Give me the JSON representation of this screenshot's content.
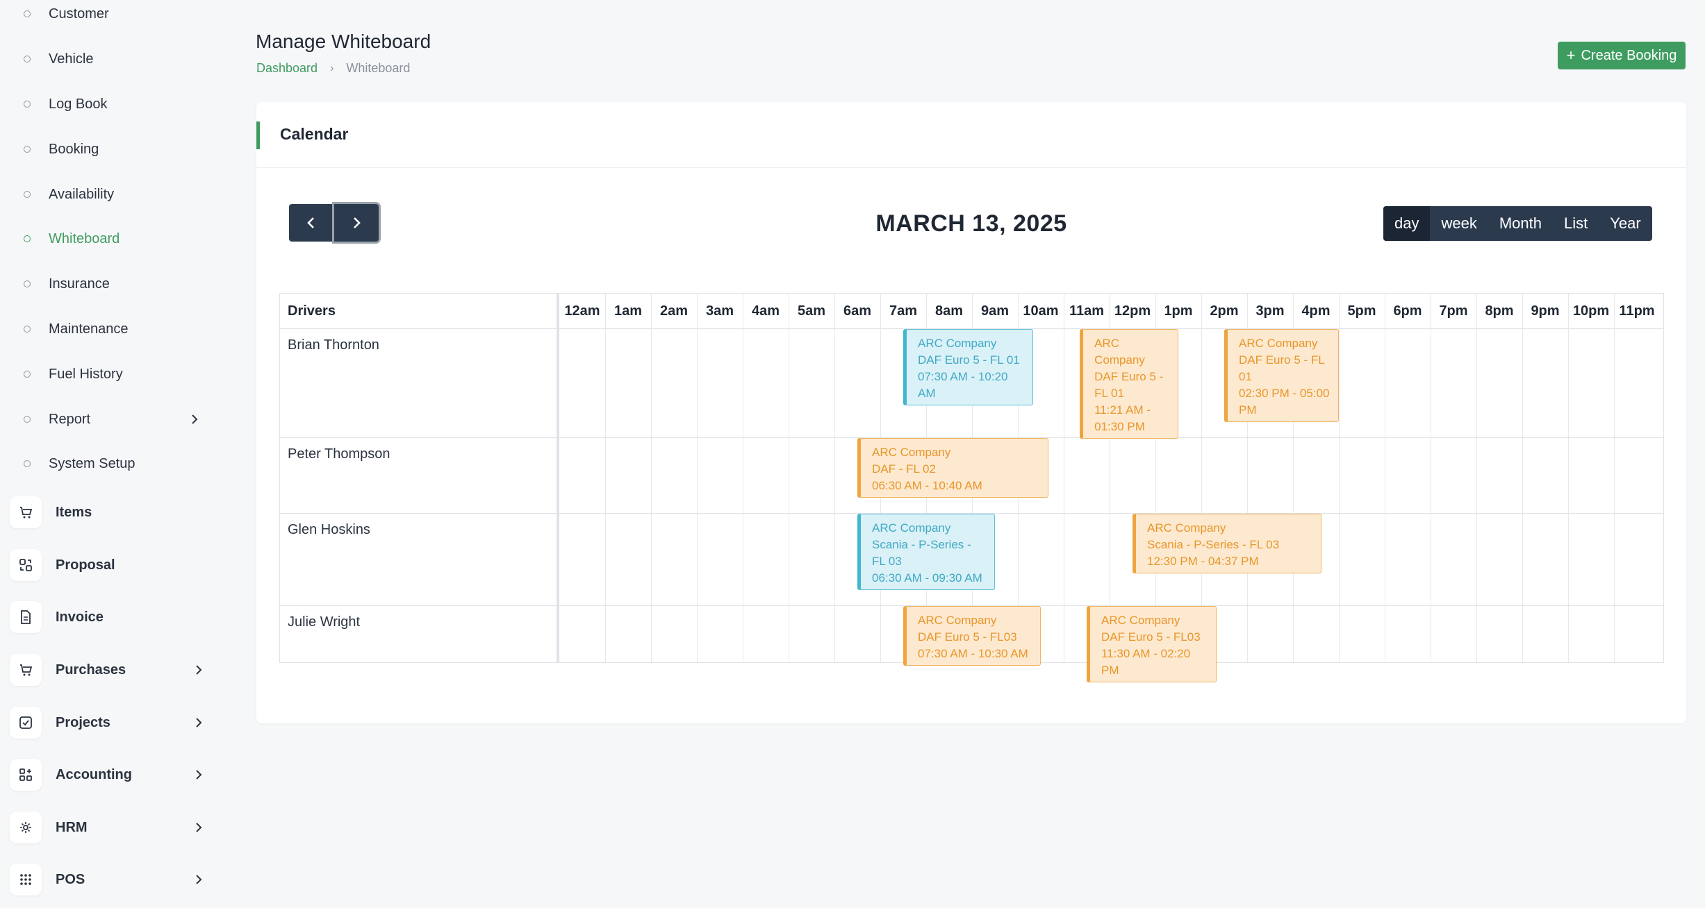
{
  "sidebar": {
    "sub_items": [
      {
        "label": "Customer"
      },
      {
        "label": "Vehicle"
      },
      {
        "label": "Log Book"
      },
      {
        "label": "Booking"
      },
      {
        "label": "Availability"
      },
      {
        "label": "Whiteboard",
        "active": true
      },
      {
        "label": "Insurance"
      },
      {
        "label": "Maintenance"
      },
      {
        "label": "Fuel History"
      },
      {
        "label": "Report",
        "has_children": true
      },
      {
        "label": "System Setup"
      }
    ],
    "main_items": [
      {
        "label": "Items",
        "icon": "cart-icon"
      },
      {
        "label": "Proposal",
        "icon": "proposal-icon"
      },
      {
        "label": "Invoice",
        "icon": "file-icon"
      },
      {
        "label": "Purchases",
        "icon": "cart-icon",
        "has_children": true
      },
      {
        "label": "Projects",
        "icon": "checkbox-icon",
        "has_children": true
      },
      {
        "label": "Accounting",
        "icon": "apps-icon",
        "has_children": true
      },
      {
        "label": "HRM",
        "icon": "hrm-icon",
        "has_children": true
      },
      {
        "label": "POS",
        "icon": "grid-dots-icon",
        "has_children": true
      }
    ]
  },
  "header": {
    "title": "Manage Whiteboard",
    "breadcrumb": {
      "home": "Dashboard",
      "separator": "›",
      "current": "Whiteboard"
    },
    "create_button": "Create Booking",
    "create_button_icon": "+"
  },
  "card": {
    "title": "Calendar"
  },
  "calendar": {
    "date_title": "MARCH 13, 2025",
    "views": [
      {
        "label": "day",
        "active": true
      },
      {
        "label": "week"
      },
      {
        "label": "Month"
      },
      {
        "label": "List"
      },
      {
        "label": "Year"
      }
    ],
    "resource_header": "Drivers",
    "hours": [
      "12am",
      "1am",
      "2am",
      "3am",
      "4am",
      "5am",
      "6am",
      "7am",
      "8am",
      "9am",
      "10am",
      "11am",
      "12pm",
      "1pm",
      "2pm",
      "3pm",
      "4pm",
      "5pm",
      "6pm",
      "7pm",
      "8pm",
      "9pm",
      "10pm",
      "11pm"
    ],
    "drivers": [
      {
        "name": "Brian Thornton"
      },
      {
        "name": "Peter Thompson"
      },
      {
        "name": "Glen Hoskins"
      },
      {
        "name": "Julie Wright"
      }
    ],
    "events": [
      {
        "driver": 0,
        "start_hour": 7.5,
        "end_hour": 10.33,
        "color": "blue",
        "company": "ARC Company",
        "vehicle": "DAF Euro 5 - FL 01",
        "time": "07:30 AM - 10:20 AM"
      },
      {
        "driver": 0,
        "start_hour": 11.35,
        "end_hour": 13.5,
        "color": "orange",
        "company": "ARC Company",
        "vehicle": "DAF Euro 5 - FL 01",
        "time": "11:21 AM - 01:30 PM"
      },
      {
        "driver": 0,
        "start_hour": 14.5,
        "end_hour": 17.0,
        "color": "orange",
        "company": "ARC Company",
        "vehicle": "DAF Euro 5 - FL 01",
        "time": "02:30 PM - 05:00 PM"
      },
      {
        "driver": 1,
        "start_hour": 6.5,
        "end_hour": 10.67,
        "color": "orange",
        "company": "ARC Company",
        "vehicle": "DAF - FL 02",
        "time": "06:30 AM - 10:40 AM"
      },
      {
        "driver": 2,
        "start_hour": 6.5,
        "end_hour": 9.5,
        "color": "blue",
        "company": "ARC Company",
        "vehicle": "Scania - P-Series - FL 03",
        "time": "06:30 AM - 09:30 AM"
      },
      {
        "driver": 2,
        "start_hour": 12.5,
        "end_hour": 16.62,
        "color": "orange",
        "company": "ARC Company",
        "vehicle": "Scania - P-Series - FL 03",
        "time": "12:30 PM - 04:37 PM"
      },
      {
        "driver": 3,
        "start_hour": 7.5,
        "end_hour": 10.5,
        "color": "orange",
        "company": "ARC Company",
        "vehicle": "DAF Euro 5 - FL03",
        "time": "07:30 AM - 10:30 AM"
      },
      {
        "driver": 3,
        "start_hour": 11.5,
        "end_hour": 14.33,
        "color": "orange",
        "company": "ARC Company",
        "vehicle": "DAF Euro 5 - FL03",
        "time": "11:30 AM - 02:20 PM"
      }
    ]
  }
}
